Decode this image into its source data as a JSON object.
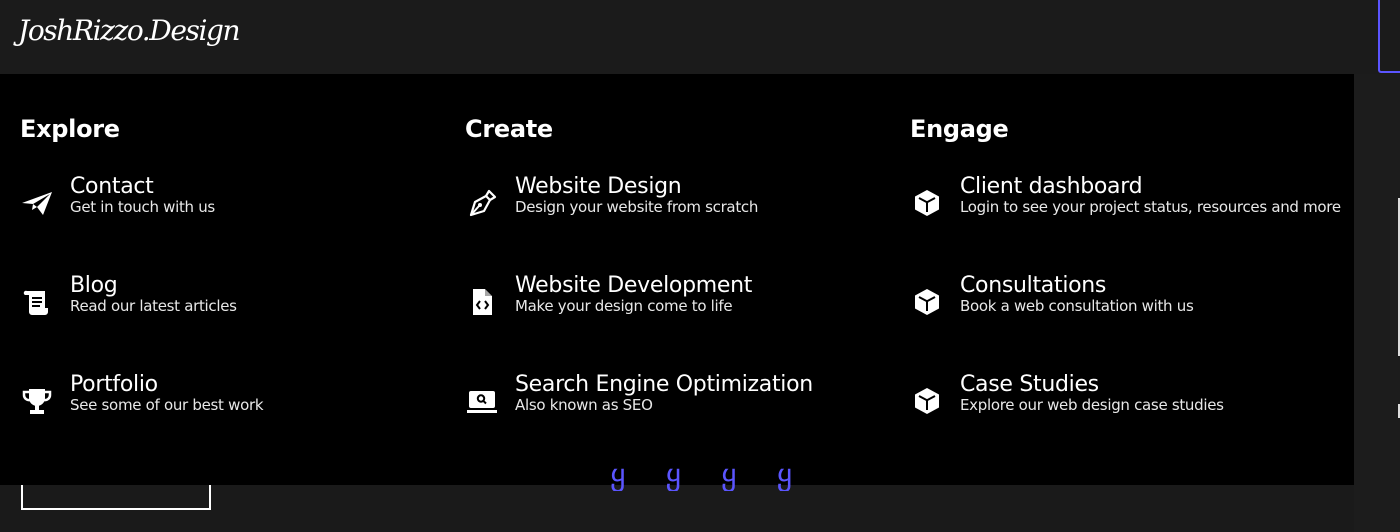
{
  "header": {
    "logo": "JoshRizzo.Design"
  },
  "menu": {
    "columns": [
      {
        "title": "Explore",
        "items": [
          {
            "title": "Contact",
            "desc": "Get in touch with us",
            "icon": "paper-plane-icon"
          },
          {
            "title": "Blog",
            "desc": "Read our latest articles",
            "icon": "scroll-icon"
          },
          {
            "title": "Portfolio",
            "desc": "See some of our best work",
            "icon": "trophy-icon"
          }
        ]
      },
      {
        "title": "Create",
        "items": [
          {
            "title": "Website Design",
            "desc": "Design your website from scratch",
            "icon": "pen-nib-icon"
          },
          {
            "title": "Website Development",
            "desc": "Make your design come to life",
            "icon": "code-file-icon"
          },
          {
            "title": "Search Engine Optimization",
            "desc": "Also known as SEO",
            "icon": "laptop-search-icon"
          }
        ]
      },
      {
        "title": "Engage",
        "items": [
          {
            "title": "Client dashboard",
            "desc": "Login to see your project status, resources and more",
            "icon": "cube-icon"
          },
          {
            "title": "Consultations",
            "desc": "Book a web consultation with us",
            "icon": "cube-icon"
          },
          {
            "title": "Case Studies",
            "desc": "Explore our web design case studies",
            "icon": "cube-icon"
          }
        ]
      }
    ]
  },
  "colors": {
    "accent": "#5b55ff",
    "menu_bg": "#000000",
    "page_bg": "#1a1a1a"
  }
}
